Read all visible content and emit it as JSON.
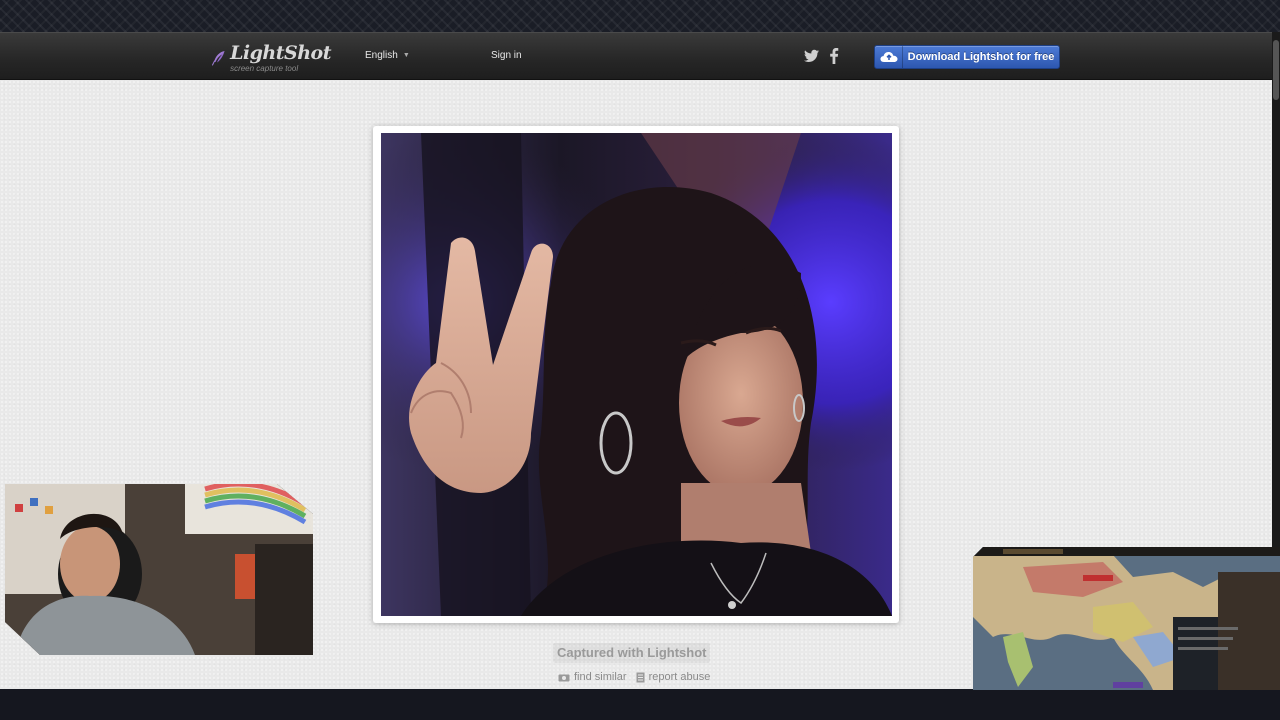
{
  "header": {
    "logo": {
      "name": "LightShot",
      "tagline": "screen capture tool"
    },
    "language": {
      "selected": "English"
    },
    "signin_label": "Sign in",
    "download_label": "Download Lightshot for free"
  },
  "screenshot": {
    "caption": "Captured with Lightshot",
    "find_similar_label": "find similar",
    "report_abuse_label": "report abuse"
  },
  "colors": {
    "header_bg": "#262626",
    "accent_blue": "#3a66c4",
    "page_bg": "#e9e9e9",
    "neon_purple": "#4a2cff"
  },
  "icons": [
    "feather-icon",
    "twitter-icon",
    "facebook-icon",
    "cloud-upload-icon",
    "camera-icon",
    "flag-icon"
  ]
}
